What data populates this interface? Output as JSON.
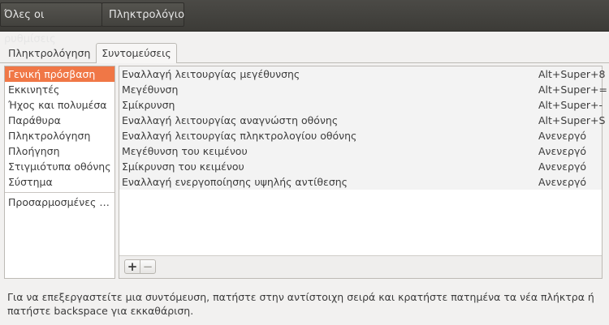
{
  "topbar": {
    "all_settings_label": "Όλες οι ρυθμίσεις",
    "current_label": "Πληκτρολόγιο"
  },
  "tabs": [
    {
      "label": "Πληκτρολόγηση"
    },
    {
      "label": "Συντομεύσεις"
    }
  ],
  "sidebar": {
    "items": [
      {
        "label": "Γενική πρόσβαση"
      },
      {
        "label": "Εκκινητές"
      },
      {
        "label": "Ήχος και πολυμέσα"
      },
      {
        "label": "Παράθυρα"
      },
      {
        "label": "Πληκτρολόγηση"
      },
      {
        "label": "Πλοήγηση"
      },
      {
        "label": "Στιγμιότυπα οθόνης"
      },
      {
        "label": "Σύστημα"
      }
    ],
    "custom_label": "Προσαρμοσμένες …"
  },
  "shortcuts": [
    {
      "name": "Εναλλαγή λειτουργίας μεγέθυνσης",
      "key": "Alt+Super+8"
    },
    {
      "name": "Μεγέθυνση",
      "key": "Alt+Super+="
    },
    {
      "name": "Σμίκρυνση",
      "key": "Alt+Super+-"
    },
    {
      "name": "Εναλλαγή λειτουργίας αναγνώστη οθόνης",
      "key": "Alt+Super+S"
    },
    {
      "name": "Εναλλαγή λειτουργίας πληκτρολογίου οθόνης",
      "key": "Ανενεργό"
    },
    {
      "name": "Μεγέθυνση του κειμένου",
      "key": "Ανενεργό"
    },
    {
      "name": "Σμίκρυνση του κειμένου",
      "key": "Ανενεργό"
    },
    {
      "name": "Εναλλαγή ενεργοποίησης υψηλής αντίθεσης",
      "key": "Ανενεργό"
    }
  ],
  "toolbar": {
    "add_label": "+",
    "remove_label": "−"
  },
  "help_text": "Για να επεξεργαστείτε μια συντόμευση, πατήστε στην αντίστοιχη σειρά και κρατήστε πατημένα τα νέα πλήκτρα ή πατήστε backspace για εκκαθάριση."
}
